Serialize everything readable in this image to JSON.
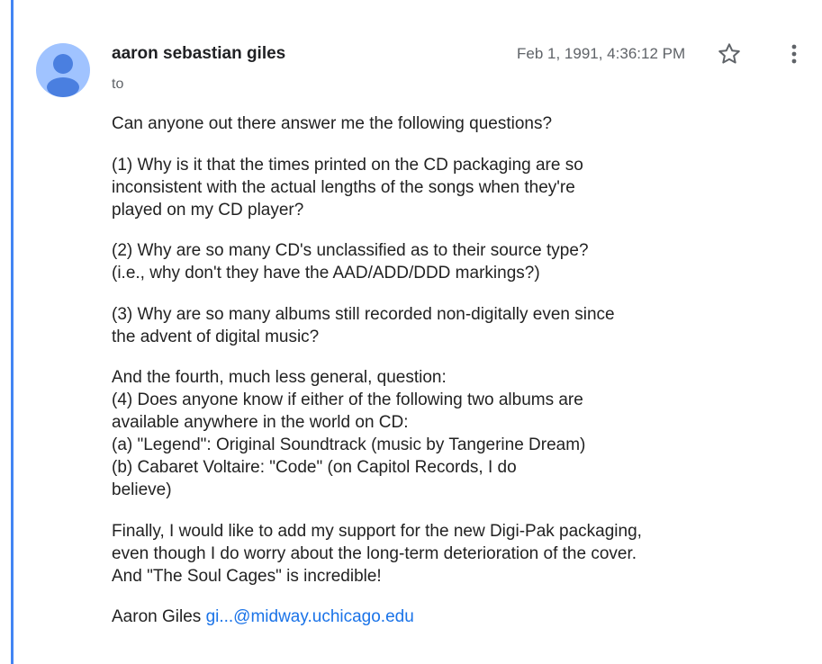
{
  "message": {
    "sender_name": "aaron sebastian giles",
    "to_label": "to",
    "timestamp": "Feb 1, 1991, 4:36:12 PM",
    "star_icon": "star-outline-icon",
    "more_icon": "more-vertical-icon",
    "avatar_icon": "person-avatar-icon",
    "accent_color": "#4285f4",
    "link_color": "#1a73e8",
    "body": {
      "p1": [
        "Can anyone out there answer me the following questions?"
      ],
      "p2": [
        "(1) Why is it that the times printed on the CD packaging are so",
        "inconsistent with the actual lengths of the songs when they're",
        "played on my CD player?"
      ],
      "p3": [
        "(2) Why are so many CD's unclassified as to their source type?",
        "(i.e., why don't they have the AAD/ADD/DDD markings?)"
      ],
      "p4": [
        "(3) Why are so many albums still recorded non-digitally even since",
        "the advent of digital music?"
      ],
      "p5": [
        "And the fourth, much less general, question:",
        "(4) Does anyone know if either of the following two albums are",
        "available anywhere in the world on CD:",
        "(a) \"Legend\": Original Soundtrack (music by Tangerine Dream)",
        "(b) Cabaret Voltaire: \"Code\" (on Capitol Records, I do",
        "believe)"
      ],
      "p6": [
        "Finally, I would like to add my support for the new Digi-Pak packaging,",
        "even though I do worry about the long-term deterioration of the cover.",
        "And \"The Soul Cages\" is incredible!"
      ]
    },
    "signature": {
      "name": "Aaron Giles",
      "email": "gi...@midway.uchicago.edu"
    }
  }
}
